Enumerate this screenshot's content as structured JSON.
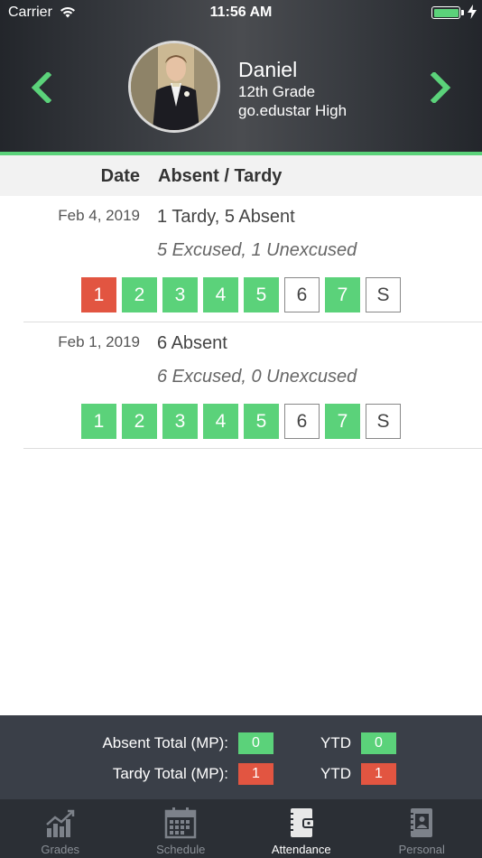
{
  "status_bar": {
    "carrier": "Carrier",
    "time": "11:56 AM"
  },
  "student": {
    "name": "Daniel",
    "grade": "12th Grade",
    "school": "go.edustar High"
  },
  "table": {
    "col_date": "Date",
    "col_absent_tardy": "Absent / Tardy"
  },
  "records": [
    {
      "date": "Feb 4, 2019",
      "summary": "1 Tardy, 5 Absent",
      "excused": "5 Excused, 1 Unexcused",
      "periods": [
        {
          "label": "1",
          "status": "tardy"
        },
        {
          "label": "2",
          "status": "absent"
        },
        {
          "label": "3",
          "status": "absent"
        },
        {
          "label": "4",
          "status": "absent"
        },
        {
          "label": "5",
          "status": "absent"
        },
        {
          "label": "6",
          "status": "present"
        },
        {
          "label": "7",
          "status": "absent"
        },
        {
          "label": "S",
          "status": "present"
        }
      ]
    },
    {
      "date": "Feb 1, 2019",
      "summary": "6 Absent",
      "excused": "6 Excused, 0 Unexcused",
      "periods": [
        {
          "label": "1",
          "status": "absent"
        },
        {
          "label": "2",
          "status": "absent"
        },
        {
          "label": "3",
          "status": "absent"
        },
        {
          "label": "4",
          "status": "absent"
        },
        {
          "label": "5",
          "status": "absent"
        },
        {
          "label": "6",
          "status": "present"
        },
        {
          "label": "7",
          "status": "absent"
        },
        {
          "label": "S",
          "status": "present"
        }
      ]
    }
  ],
  "totals": {
    "absent_label": "Absent Total (MP):",
    "absent_mp": "0",
    "absent_ytd_label": "YTD",
    "absent_ytd": "0",
    "tardy_label": "Tardy Total (MP):",
    "tardy_mp": "1",
    "tardy_ytd_label": "YTD",
    "tardy_ytd": "1"
  },
  "tabs": [
    {
      "label": "Grades",
      "icon": "chart-icon",
      "active": false
    },
    {
      "label": "Schedule",
      "icon": "calendar-icon",
      "active": false
    },
    {
      "label": "Attendance",
      "icon": "attendance-book-icon",
      "active": true
    },
    {
      "label": "Personal",
      "icon": "contact-book-icon",
      "active": false
    }
  ],
  "colors": {
    "accent_green": "#5bd27a",
    "tardy_red": "#e25541",
    "header_dark": "#2b2f35"
  }
}
